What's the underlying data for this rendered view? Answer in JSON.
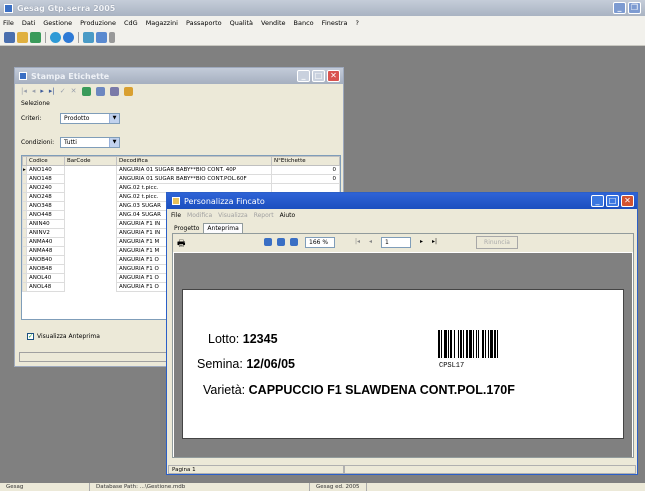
{
  "app": {
    "title": "Gesag Gtp.serra 2005",
    "menu": [
      "File",
      "Dati",
      "Gestione",
      "Produzione",
      "CdG",
      "Magazzini",
      "Passaporto",
      "Qualità",
      "Vendite",
      "Banco",
      "Finestra",
      "?"
    ]
  },
  "stampa_etichette": {
    "title": "Stampa Etichette",
    "selezione_label": "Selezione",
    "criteri_label": "Criteri:",
    "criteri_value": "Prodotto",
    "condizioni_label": "Condizioni:",
    "condizioni_value": "Tutti",
    "columns": [
      "Codice",
      "BarCode",
      "Decodifica",
      "N°Etichette"
    ],
    "rows": [
      {
        "codice": "ANO140",
        "decodifica": "ANGURIA 01 SUGAR BABY**BIO CONT. 40P",
        "n": "0"
      },
      {
        "codice": "ANO148",
        "decodifica": "ANGURIA 01 SUGAR BABY**BIO CONT.POL.60F",
        "n": "0"
      },
      {
        "codice": "ANO240",
        "decodifica": "ANG.02 t.picc.",
        "n": ""
      },
      {
        "codice": "ANO248",
        "decodifica": "ANG.02 t.picc.",
        "n": ""
      },
      {
        "codice": "ANO348",
        "decodifica": "ANG.03 SUGAR",
        "n": ""
      },
      {
        "codice": "ANO448",
        "decodifica": "ANG.04 SUGAR",
        "n": ""
      },
      {
        "codice": "ANIN40",
        "decodifica": "ANGURIA F1 IN",
        "n": ""
      },
      {
        "codice": "ANINV2",
        "decodifica": "ANGURIA F1 IN",
        "n": ""
      },
      {
        "codice": "ANMA40",
        "decodifica": "ANGURIA F1 M",
        "n": ""
      },
      {
        "codice": "ANMA48",
        "decodifica": "ANGURIA F1 M",
        "n": ""
      },
      {
        "codice": "ANOB40",
        "decodifica": "ANGURIA F1 O",
        "n": ""
      },
      {
        "codice": "ANOB48",
        "decodifica": "ANGURIA F1 O",
        "n": ""
      },
      {
        "codice": "ANOL40",
        "decodifica": "ANGURIA F1 O",
        "n": ""
      },
      {
        "codice": "ANOL48",
        "decodifica": "ANGURIA F1 O",
        "n": ""
      }
    ],
    "visualizza_label": "Visualizza Anteprima"
  },
  "fincato": {
    "title": "Personalizza Fincato",
    "menu": {
      "file": "File",
      "modifica": "Modifica",
      "visualizza": "Visualizza",
      "report": "Report",
      "aiuto": "Aiuto"
    },
    "tabs": {
      "progetto": "Progetto",
      "anteprima": "Anteprima"
    },
    "zoom": "166 %",
    "page": "1",
    "rinuncia": "Rinuncia",
    "label": {
      "lotto_key": "Lotto:",
      "lotto_val": "12345",
      "semina_key": "Semina:",
      "semina_val": "12/06/05",
      "varieta_key": "Varietà:",
      "varieta_val": "CAPPUCCIO F1 SLAWDENA CONT.POL.170F",
      "barcode_text": "CPSL17"
    },
    "status_page": "Pagina 1"
  },
  "statusbar": [
    "Gesag",
    "Database Path: ...\\Gestione.mdb",
    "Gesag ed. 2005"
  ]
}
